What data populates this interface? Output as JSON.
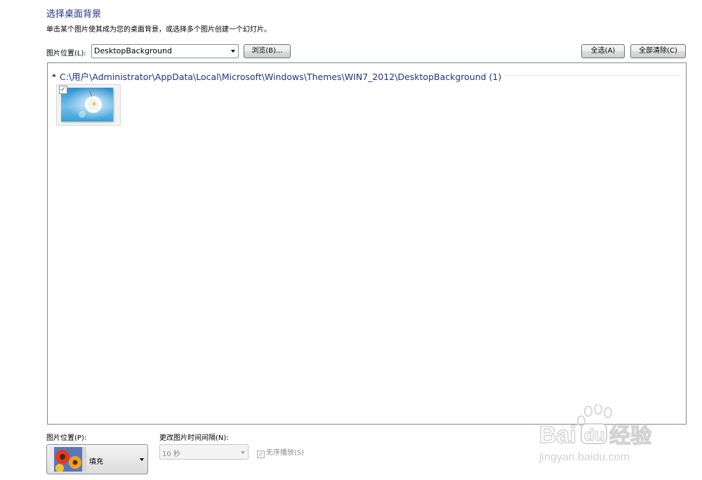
{
  "header": {
    "title": "选择桌面背景",
    "subtitle": "单击某个图片使其成为您的桌面背景，或选择多个图片创建一个幻灯片。"
  },
  "location": {
    "label": "图片位置(L):",
    "value": "DesktopBackground",
    "browse_label": "浏览(B)..."
  },
  "actions": {
    "select_all_label": "全选(A)",
    "clear_all_label": "全部清除(C)"
  },
  "gallery": {
    "group_path": "C:\\用户\\Administrator\\AppData\\Local\\Microsoft\\Windows\\Themes\\WIN7_2012\\DesktopBackground (1)",
    "items": [
      {
        "checked": true,
        "check_mark": "✓",
        "image": "white-dandelion-on-blue-sky"
      }
    ]
  },
  "picture_position": {
    "label": "图片位置(P):",
    "value": "填充",
    "preview_image": "orange-flowers"
  },
  "interval": {
    "label": "更改图片时间间隔(N):",
    "value": "10 秒",
    "enabled": false
  },
  "shuffle": {
    "label": "无序播放(S)",
    "checked": true,
    "check_mark": "✓",
    "enabled": false
  },
  "watermark": {
    "text_main": "Baidu经验",
    "text_url": "jingyan.baidu.com"
  },
  "colors": {
    "title_blue": "#1e3287",
    "panel_border": "#828790",
    "disabled_text": "#8a8a8a"
  }
}
